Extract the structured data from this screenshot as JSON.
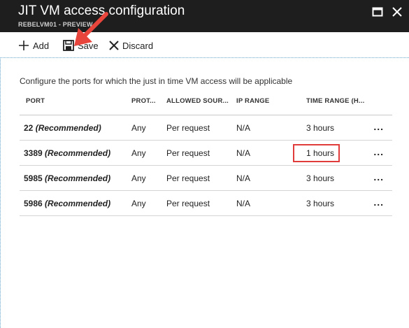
{
  "window": {
    "title": "JIT VM access configuration",
    "subtitle": "REBELVM01 - PREVIEW"
  },
  "toolbar": {
    "add_label": "Add",
    "save_label": "Save",
    "discard_label": "Discard"
  },
  "description": "Configure the ports for which the just in time VM access will be applicable",
  "table": {
    "headers": [
      "PORT",
      "PROT...",
      "ALLOWED SOUR...",
      "IP RANGE",
      "TIME RANGE (H..."
    ],
    "rows": [
      {
        "port": "22",
        "note": "(Recommended)",
        "protocol": "Any",
        "allowed_source": "Per request",
        "ip_range": "N/A",
        "time_range": "3 hours",
        "more": "..."
      },
      {
        "port": "3389",
        "note": "(Recommended)",
        "protocol": "Any",
        "allowed_source": "Per request",
        "ip_range": "N/A",
        "time_range": "1 hours",
        "more": "..."
      },
      {
        "port": "5985",
        "note": "(Recommended)",
        "protocol": "Any",
        "allowed_source": "Per request",
        "ip_range": "N/A",
        "time_range": "3 hours",
        "more": "..."
      },
      {
        "port": "5986",
        "note": "(Recommended)",
        "protocol": "Any",
        "allowed_source": "Per request",
        "ip_range": "N/A",
        "time_range": "3 hours",
        "more": "..."
      }
    ]
  },
  "annotations": {
    "arrow_color": "#e8453c",
    "highlight_color": "#e03c3c"
  }
}
